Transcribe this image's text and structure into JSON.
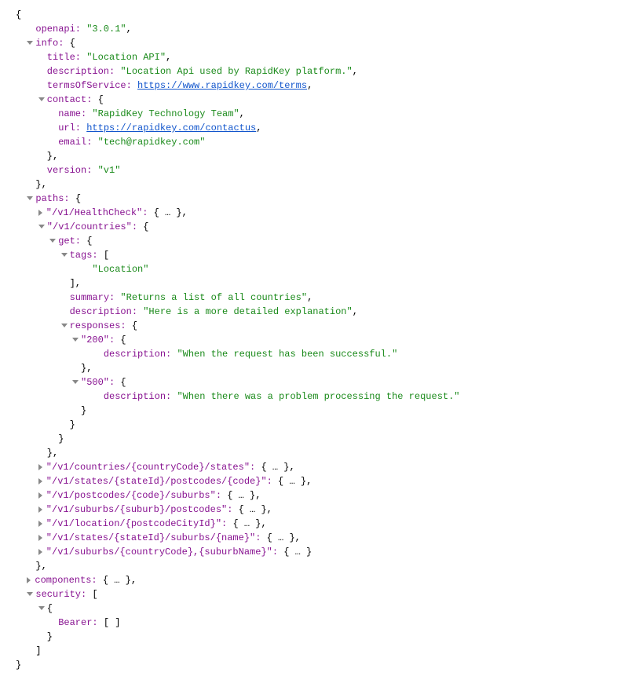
{
  "root": {
    "openapi_key": "openapi:",
    "openapi_val": "\"3.0.1\"",
    "info_key": "info:",
    "info": {
      "title_key": "title:",
      "title_val": "\"Location API\"",
      "description_key": "description:",
      "description_val": "\"Location Api used by RapidKey platform.\"",
      "terms_key": "termsOfService:",
      "terms_link": "https://www.rapidkey.com/terms",
      "contact_key": "contact:",
      "contact": {
        "name_key": "name:",
        "name_val": "\"RapidKey Technology Team\"",
        "url_key": "url:",
        "url_link": "https://rapidkey.com/contactus",
        "email_key": "email:",
        "email_val": "\"tech@rapidkey.com\""
      },
      "version_key": "version:",
      "version_val": "\"v1\""
    },
    "paths_key": "paths:",
    "paths": {
      "healthcheck_key": "\"/v1/HealthCheck\":",
      "healthcheck_collapsed": "{ … }",
      "countries_key": "\"/v1/countries\":",
      "countries": {
        "get_key": "get:",
        "get": {
          "tags_key": "tags:",
          "tags_val": "\"Location\"",
          "summary_key": "summary:",
          "summary_val": "\"Returns a list of all countries\"",
          "description_key": "description:",
          "description_val": "\"Here is a more detailed explanation\"",
          "responses_key": "responses:",
          "responses": {
            "r200_key": "\"200\":",
            "r200_desc_key": "description:",
            "r200_desc_val": "\"When the request has been successful.\"",
            "r500_key": "\"500\":",
            "r500_desc_key": "description:",
            "r500_desc_val": "\"When there was a problem processing the request.\""
          }
        }
      },
      "p1_key": "\"/v1/countries/{countryCode}/states\":",
      "p2_key": "\"/v1/states/{stateId}/postcodes/{code}\":",
      "p3_key": "\"/v1/postcodes/{code}/suburbs\":",
      "p4_key": "\"/v1/suburbs/{suburb}/postcodes\":",
      "p5_key": "\"/v1/location/{postcodeCityId}\":",
      "p6_key": "\"/v1/states/{stateId}/suburbs/{name}\":",
      "p7_key": "\"/v1/suburbs/{countryCode},{suburbName}\":",
      "collapsed": "{ … }",
      "collapsed_last": "{ … }"
    },
    "components_key": "components:",
    "components_collapsed": "{ … }",
    "security_key": "security:",
    "security": {
      "bearer_key": "Bearer:",
      "bearer_val": "[ ]"
    }
  },
  "punct": {
    "open_brace": "{",
    "close_brace": "}",
    "open_bracket": "[",
    "close_bracket": "]",
    "comma": ",",
    "close_brace_comma": "},",
    "close_bracket_comma": "],"
  }
}
